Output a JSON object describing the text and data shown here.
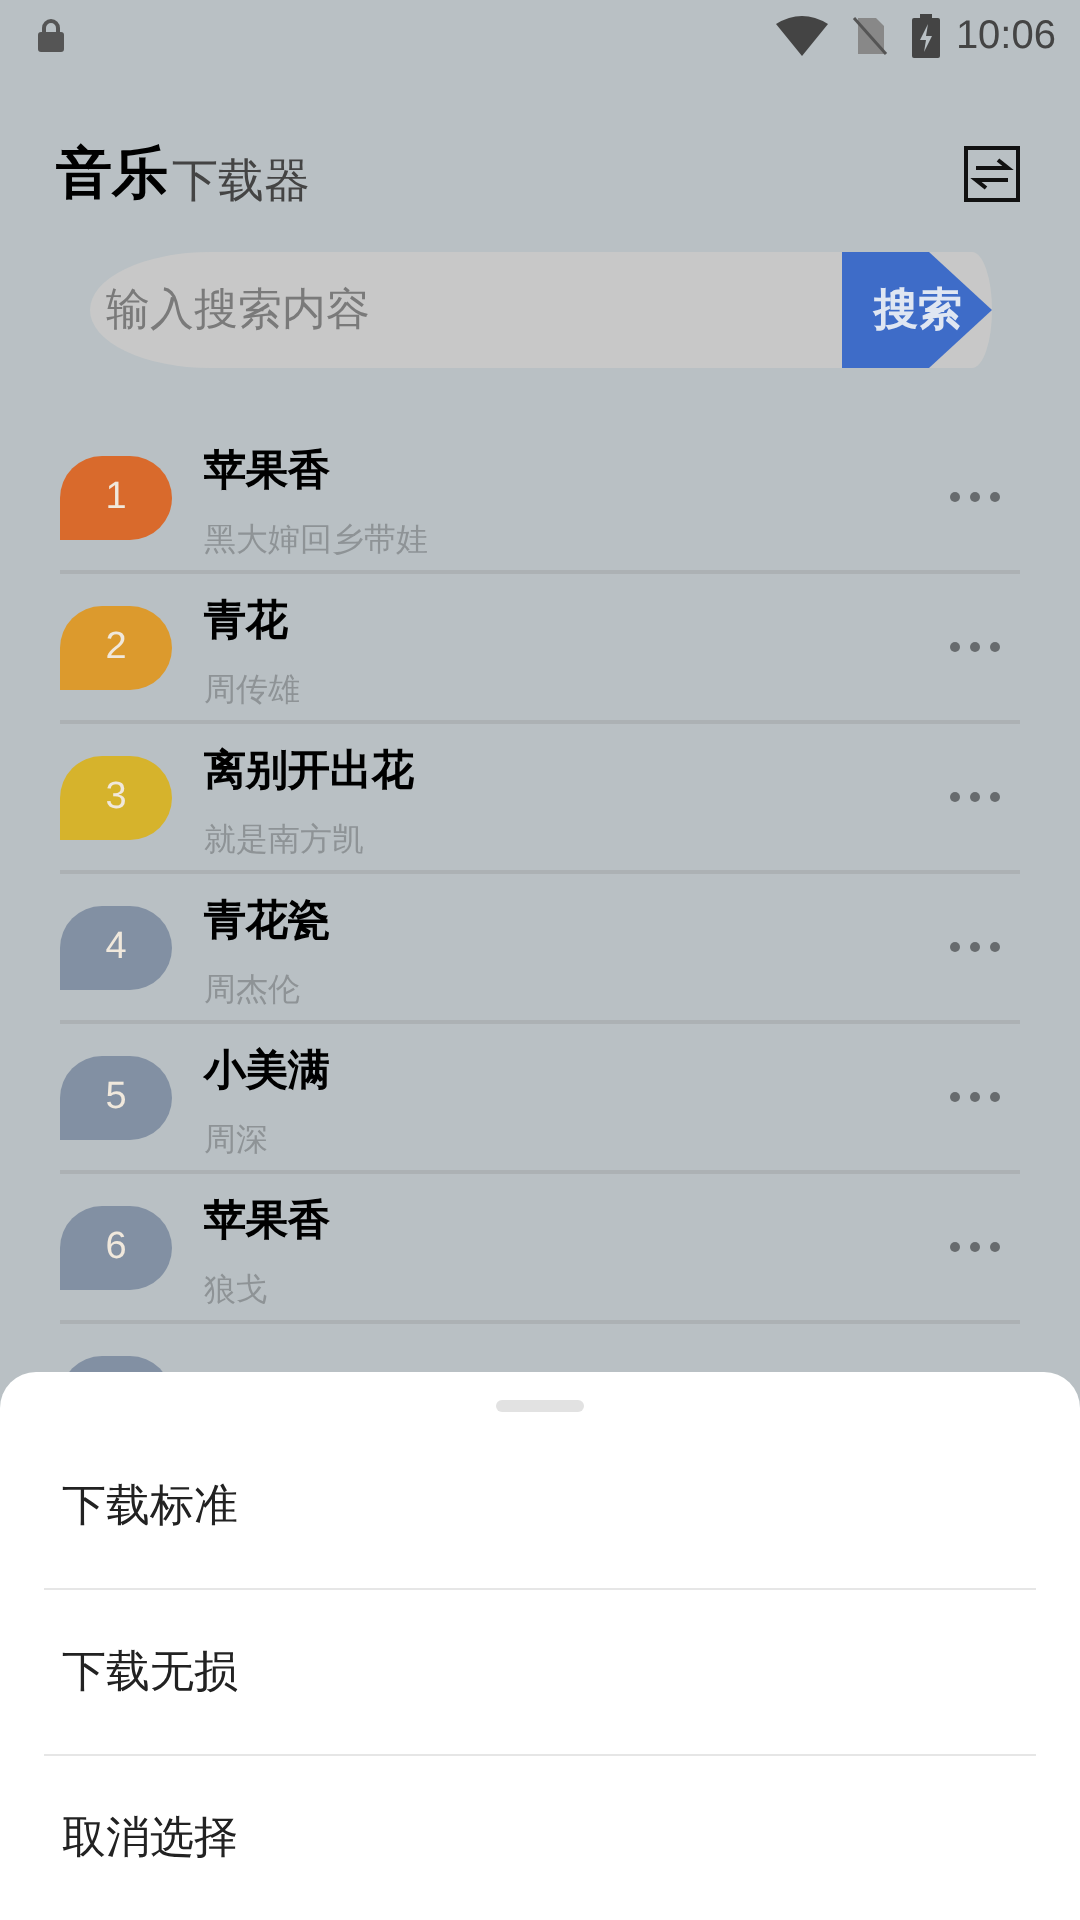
{
  "status_bar": {
    "time": "10:06"
  },
  "header": {
    "title": "音乐",
    "subtitle": "下载器"
  },
  "search": {
    "placeholder": "输入搜索内容",
    "button": "搜索"
  },
  "songs": [
    {
      "rank": "1",
      "title": "苹果香",
      "artist": "黑大婶回乡带娃",
      "color": "#d96a2c"
    },
    {
      "rank": "2",
      "title": "青花",
      "artist": "周传雄",
      "color": "#dc9a2d"
    },
    {
      "rank": "3",
      "title": "离别开出花",
      "artist": "就是南方凯",
      "color": "#d6b32c"
    },
    {
      "rank": "4",
      "title": "青花瓷",
      "artist": "周杰伦",
      "color": "#8290a3"
    },
    {
      "rank": "5",
      "title": "小美满",
      "artist": "周深",
      "color": "#8290a3"
    },
    {
      "rank": "6",
      "title": "苹果香",
      "artist": "狼戈",
      "color": "#8290a3"
    },
    {
      "color": "#8290a3"
    }
  ],
  "sheet": {
    "options": [
      "下载标准",
      "下载无损",
      "取消选择"
    ]
  }
}
